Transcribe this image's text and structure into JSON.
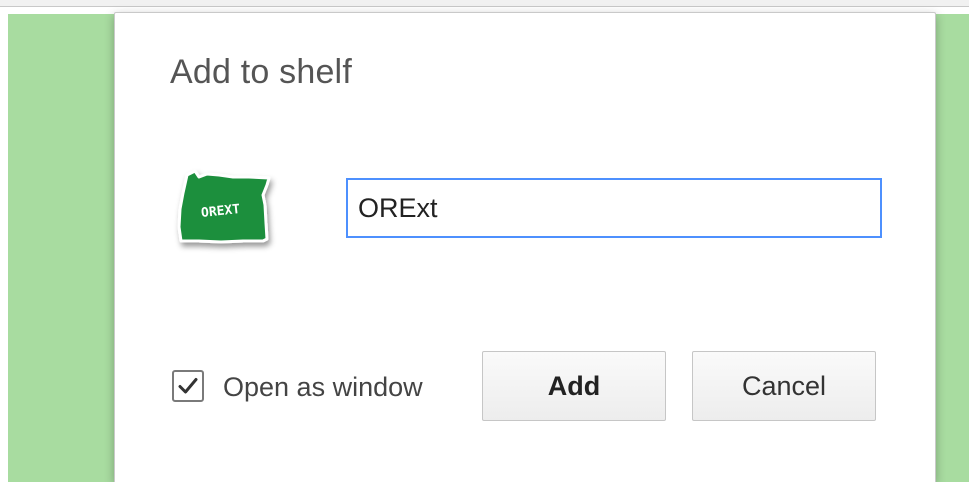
{
  "dialog": {
    "title": "Add to shelf",
    "app_icon": {
      "icon_name": "orext-oregon-logo-icon",
      "logo_text": "OREXT",
      "color": "#1e8f3e"
    },
    "name_field": {
      "value": "ORExt",
      "placeholder": ""
    },
    "open_as_window": {
      "label": "Open as window",
      "checked": true
    },
    "buttons": {
      "add_label": "Add",
      "cancel_label": "Cancel"
    }
  },
  "colors": {
    "background": "#a8dca0",
    "input_focus_border": "#4d90fe"
  }
}
